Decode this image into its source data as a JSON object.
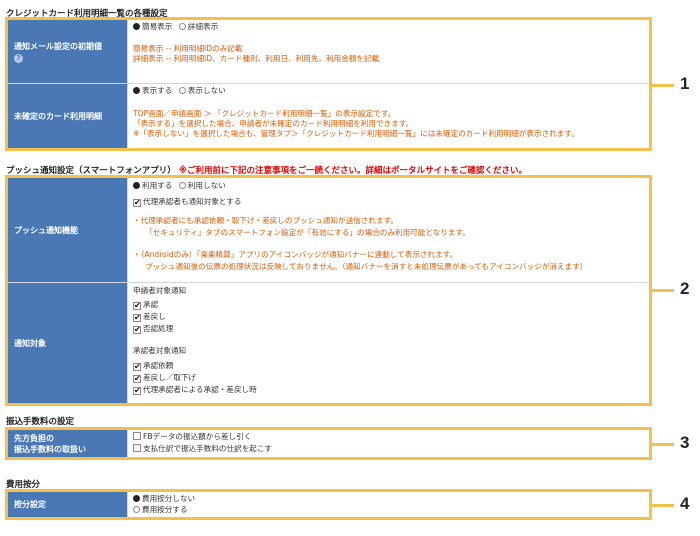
{
  "sections": {
    "card": {
      "title": "クレジットカード利用明細一覧の各種設定",
      "notify_default": {
        "label": "通知メール設定の初期値",
        "help_icon": "?",
        "options": [
          "簡易表示",
          "詳細表示"
        ],
        "selected": 0,
        "desc": [
          "簡易表示 -- 利用明細IDのみ記載",
          "詳細表示 -- 利用明細ID、カード種別、利用日、利用先、利用金額を記載"
        ]
      },
      "unconfirmed": {
        "label": "未確定のカード利用明細",
        "options": [
          "表示する",
          "表示しない"
        ],
        "selected": 0,
        "desc": [
          "TOP画面／申請画面 ＞ 「クレジットカード利用明細一覧」の表示設定です。",
          "「表示する」を選択した場合、申請者が未確定のカード利用明細を利用できます。",
          "※「表示しない」を選択した場合も、管理タブ＞「クレジットカード利用明細一覧」には未確定のカード利用明細が表示されます。"
        ]
      }
    },
    "push": {
      "title": "プッシュ通知設定（スマートフォンアプリ）",
      "warning": "※ご利用前に下記の注意事項をご一読ください。詳細はポータルサイトをご確認ください。",
      "feature": {
        "label": "プッシュ通知機能",
        "options": [
          "利用する",
          "利用しない"
        ],
        "selected": 0,
        "proxy_check": "代理承認者も通知対象とする",
        "proxy_checked": true,
        "notes": [
          "・代理承認者にも承認依頼・取下げ・差戻しのプッシュ通知が送信されます。",
          "「セキュリティ」タブのスマートフォン設定が「有効にする」の場合のみ利用可能となります。",
          "・（Androidのみ）「楽楽精算」アプリのアイコンバッジが通知バナーに連動して表示されます。",
          "プッシュ通知後の伝票の処理状況は反映しておりません。（通知バナーを消すと未処理伝票があってもアイコンバッジが消えます）"
        ]
      },
      "targets": {
        "label": "通知対象",
        "applicant_heading": "申請者対象通知",
        "applicant_items": [
          "承認",
          "差戻し",
          "否認処理"
        ],
        "approver_heading": "承認者対象通知",
        "approver_items": [
          "承認依頼",
          "差戻し／取下げ",
          "代理承認者による承認・差戻し時"
        ]
      }
    },
    "fee": {
      "title": "振込手数料の設定",
      "row": {
        "label_line1": "先方負担の",
        "label_line2": "振込手数料の取扱い",
        "items": [
          "FBデータの振込額から差し引く",
          "支払仕訳で振込手数料の仕訳を起こす"
        ]
      }
    },
    "split": {
      "title": "費用按分",
      "row": {
        "label": "按分設定",
        "options": [
          "費用按分しない",
          "費用按分する"
        ],
        "selected": 0
      }
    }
  },
  "callouts": [
    "1",
    "2",
    "3",
    "4"
  ],
  "colors": {
    "label_bg": "#4a78b5",
    "frame": "#f5c04a",
    "note": "#e05a00",
    "warning": "#e00000"
  }
}
